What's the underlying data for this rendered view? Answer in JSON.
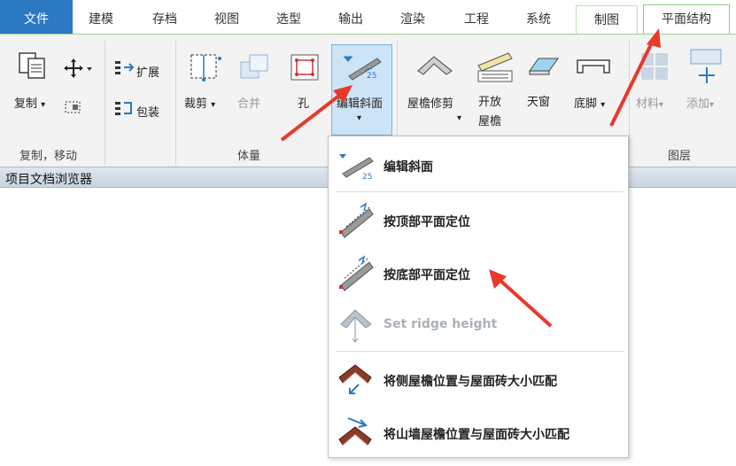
{
  "tabs": [
    {
      "label": "文件"
    },
    {
      "label": "建模"
    },
    {
      "label": "存档"
    },
    {
      "label": "视图"
    },
    {
      "label": "选型"
    },
    {
      "label": "输出"
    },
    {
      "label": "渲染"
    },
    {
      "label": "工程"
    },
    {
      "label": "系统"
    },
    {
      "label": "制图"
    },
    {
      "label": "平面结构"
    }
  ],
  "ribbon": {
    "copy_label": "复制",
    "move_arrow": "▾",
    "extend_label": "扩展",
    "wrap_label": "包装",
    "crop_label": "裁剪",
    "merge_label": "合并",
    "hole_label": "孔",
    "edit_slope_label": "编辑斜面",
    "roof_trim_label": "屋檐修剪",
    "open_eave_line1": "开放",
    "open_eave_line2": "屋檐",
    "skylight_label": "天窗",
    "footing_label": "底脚",
    "material_label": "材料",
    "add_label": "添加",
    "groups": {
      "copy_move": "复制，移动",
      "volume": "体量",
      "layer": "图层"
    }
  },
  "browser": {
    "title": "项目文档浏览器"
  },
  "menu": {
    "items": [
      {
        "label": "编辑斜面",
        "enabled": true
      },
      {
        "label": "按顶部平面定位",
        "enabled": true
      },
      {
        "label": "按底部平面定位",
        "enabled": true
      },
      {
        "label": "Set ridge height",
        "enabled": false
      },
      {
        "label": "将侧屋檐位置与屋面砖大小匹配",
        "enabled": true
      },
      {
        "label": "将山墙屋檐位置与屋面砖大小匹配",
        "enabled": true
      }
    ]
  },
  "colors": {
    "file_tab": "#2b79c2",
    "annotation_arrow": "#e8392b",
    "active_tab_border": "#8ed07b"
  }
}
